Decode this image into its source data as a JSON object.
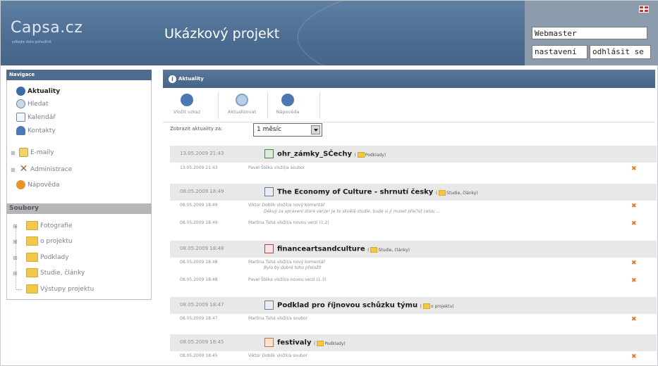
{
  "header": {
    "logo_title": "Capsa.cz",
    "logo_subtitle": "sdílejte data pohodlně",
    "project_title": "Ukázkový projekt",
    "user_name": "Webmaster",
    "settings_label": "nastavení",
    "logout_label": "odhlásit se"
  },
  "nav": {
    "heading": "Navigace",
    "items": [
      {
        "label": "Aktuality",
        "icon": "info-icon"
      },
      {
        "label": "Hledat",
        "icon": "magnifier-icon"
      },
      {
        "label": "Kalendář",
        "icon": "calendar-icon"
      },
      {
        "label": "Kontakty",
        "icon": "contacts-icon"
      },
      {
        "label": "E-maily",
        "icon": "email-icon"
      },
      {
        "label": "Administrace",
        "icon": "tools-icon"
      },
      {
        "label": "Nápověda",
        "icon": "help-icon"
      }
    ]
  },
  "files": {
    "heading": "Soubory",
    "folders": [
      "Fotografie",
      "o projektu",
      "Podklady",
      "Studie, články",
      "Výstupy projektu"
    ]
  },
  "main": {
    "heading": "Aktuality",
    "toolbar": [
      "Vložit vzkaz",
      "Aktualizovat",
      "Nápověda"
    ],
    "filter_label": "Zobrazit aktuality za:",
    "filter_value": "1 měsíc"
  },
  "entries": [
    {
      "time": "13.05.2009 21:43",
      "title": "ohr_zámky_SČechy",
      "category": "Podklady",
      "icon": "excel-file-icon",
      "subs": [
        {
          "time": "13.05.2009 21:43",
          "text": "Pavel Štěka vložil/a soubor"
        }
      ]
    },
    {
      "time": "08.05.2009 18:49",
      "title": "The Economy of Culture - shrnutí česky",
      "category": "Studie, články",
      "icon": "word-file-icon",
      "subs": [
        {
          "time": "08.05.2009 18:49",
          "text": "Viktor Doblik vložil/a nový komentář",
          "comment": "Děkuji za opravení staré verze! Je to skvělá studie, bude si ji muset přečíst celou ..."
        },
        {
          "time": "08.05.2009 18:49",
          "text": "Martina Tuhá vložil/a novou verzi (1.2)"
        }
      ]
    },
    {
      "time": "08.05.2009 18:48",
      "title": "financeartsandculture",
      "category": "Studie, články",
      "icon": "pdf-file-icon",
      "subs": [
        {
          "time": "08.05.2009 18:48",
          "text": "Martina Tuhá vložil/a nový komentář",
          "comment": "Bylo by dobré toho přeložit"
        },
        {
          "time": "08.05.2009 18:48",
          "text": "Pavel Štěka vložil/a novou verzi (1.3)"
        }
      ]
    },
    {
      "time": "08.05.2009 18:47",
      "title": "Podklad pro říjnovou schůzku týmu",
      "category": "o projektu",
      "icon": "word-file-icon",
      "subs": [
        {
          "time": "08.05.2009 18:47",
          "text": "Martina Tuhá vložil/a soubor"
        }
      ]
    },
    {
      "time": "08.05.2009 18:45",
      "title": "festivaly",
      "category": "Podklady",
      "icon": "presentation-file-icon",
      "subs": [
        {
          "time": "08.05.2009 18:45",
          "text": "Viktor Doblik vložil/a soubor"
        }
      ]
    }
  ],
  "colors": {
    "header_bg": "#4d6c92",
    "nav_head": "#4f6b90",
    "entry_bg": "#e8e8e8",
    "delete_accent": "#e07a22",
    "folder": "#f2c84b"
  }
}
